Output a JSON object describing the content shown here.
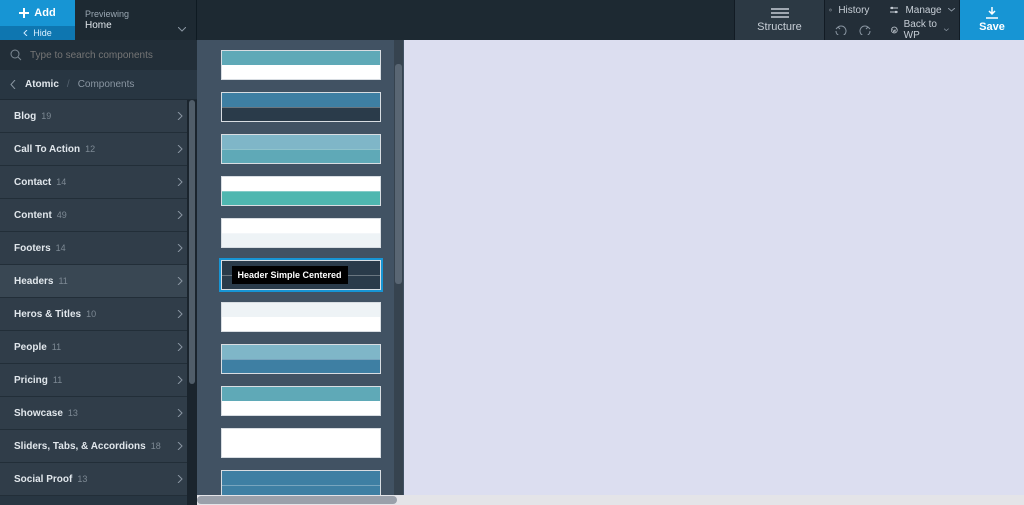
{
  "top": {
    "add": "Add",
    "hide": "Hide",
    "previewing": "Previewing",
    "page": "Home",
    "structure": "Structure",
    "history": "History",
    "manage": "Manage",
    "backwp": "Back to WP",
    "save": "Save"
  },
  "search": {
    "placeholder": "Type to search components"
  },
  "crumbs": {
    "root": "Atomic",
    "current": "Components"
  },
  "cats": [
    {
      "name": "Blog",
      "count": "19"
    },
    {
      "name": "Call To Action",
      "count": "12"
    },
    {
      "name": "Contact",
      "count": "14"
    },
    {
      "name": "Content",
      "count": "49"
    },
    {
      "name": "Footers",
      "count": "14"
    },
    {
      "name": "Headers",
      "count": "11",
      "sel": true
    },
    {
      "name": "Heros & Titles",
      "count": "10"
    },
    {
      "name": "People",
      "count": "11"
    },
    {
      "name": "Pricing",
      "count": "11"
    },
    {
      "name": "Showcase",
      "count": "13"
    },
    {
      "name": "Sliders, Tabs, & Accordions",
      "count": "18"
    },
    {
      "name": "Social Proof",
      "count": "13"
    }
  ],
  "preview_tooltip": "Header Simple Centered",
  "components": [
    {
      "rows": [
        "teal",
        "white"
      ]
    },
    {
      "rows": [
        "blue",
        "dark"
      ]
    },
    {
      "rows": [
        "mid",
        "teal"
      ]
    },
    {
      "rows": [
        "white",
        "aqua"
      ]
    },
    {
      "rows": [
        "white",
        "lt"
      ]
    },
    {
      "rows": [
        "dark",
        "dark"
      ],
      "sel": true
    },
    {
      "rows": [
        "lt",
        "white"
      ]
    },
    {
      "rows": [
        "mid",
        "blue"
      ]
    },
    {
      "rows": [
        "teal",
        "white"
      ]
    },
    {
      "rows": [
        "white",
        "white"
      ]
    },
    {
      "rows": [
        "blue",
        "blue"
      ]
    }
  ]
}
